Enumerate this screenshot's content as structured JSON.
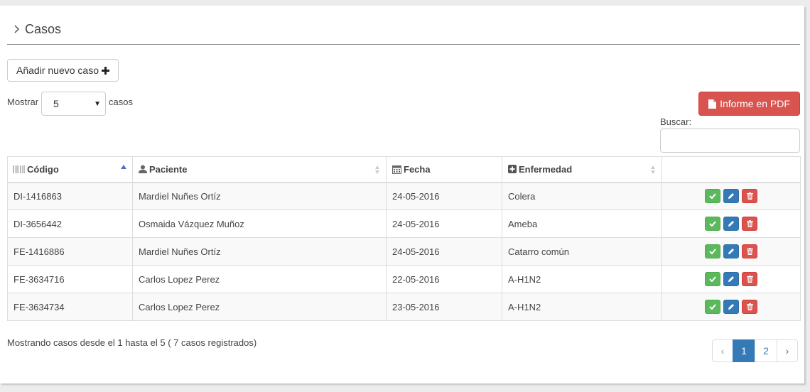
{
  "header": {
    "title": "Casos"
  },
  "toolbar": {
    "add_label": "Añadir nuevo caso",
    "pdf_label": "Informe en PDF"
  },
  "length_menu": {
    "prefix": "Mostrar",
    "value": "5",
    "suffix": "casos"
  },
  "search": {
    "label": "Buscar:",
    "value": ""
  },
  "table": {
    "columns": [
      {
        "label": "Código",
        "icon": "barcode-icon",
        "sort": "asc"
      },
      {
        "label": "Paciente",
        "icon": "user-icon",
        "sort": "none"
      },
      {
        "label": "Fecha",
        "icon": "calendar-icon",
        "sort": "none"
      },
      {
        "label": "Enfermedad",
        "icon": "plus-square-icon",
        "sort": "none"
      },
      {
        "label": "",
        "icon": "",
        "sort": "none"
      }
    ],
    "rows": [
      [
        "DI-1416863",
        "Mardiel Nuñes Ortíz",
        "24-05-2016",
        "Colera"
      ],
      [
        "DI-3656442",
        "Osmaida Vázquez Muñoz",
        "24-05-2016",
        "Ameba"
      ],
      [
        "FE-1416886",
        "Mardiel Nuñes Ortíz",
        "24-05-2016",
        "Catarro común"
      ],
      [
        "FE-3634716",
        "Carlos Lopez Perez",
        "22-05-2016",
        "A-H1N2"
      ],
      [
        "FE-3634734",
        "Carlos Lopez Perez",
        "23-05-2016",
        "A-H1N2"
      ]
    ],
    "row_actions": [
      "check-icon",
      "pencil-icon",
      "trash-icon"
    ]
  },
  "info": "Mostrando casos desde el 1 hasta el 5 ( 7 casos registrados)",
  "pagination": {
    "prev": "‹",
    "pages": [
      "1",
      "2"
    ],
    "active": "1",
    "next": "›"
  },
  "colors": {
    "danger": "#d9534f",
    "success": "#5cb85c",
    "primary": "#337ab7"
  }
}
